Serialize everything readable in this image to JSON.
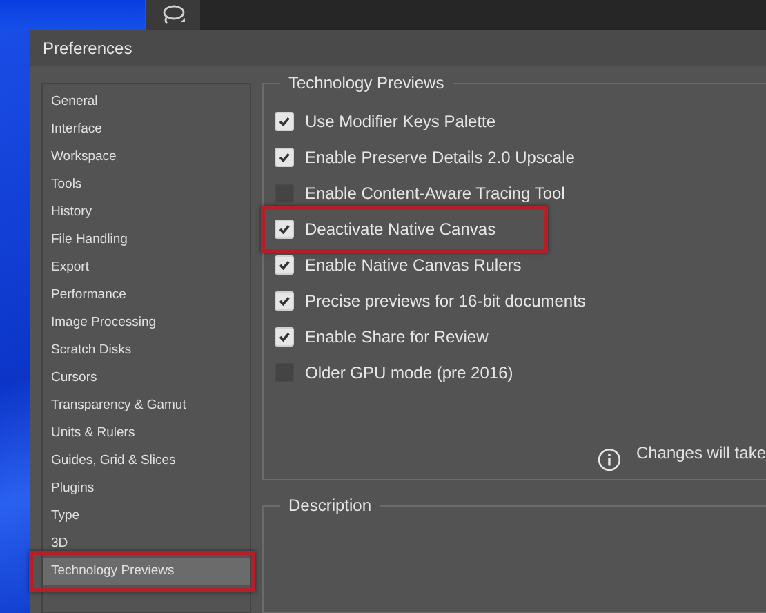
{
  "window": {
    "title": "Preferences"
  },
  "sidebar": {
    "items": [
      {
        "label": "General",
        "selected": false,
        "highlighted": false
      },
      {
        "label": "Interface",
        "selected": false,
        "highlighted": false
      },
      {
        "label": "Workspace",
        "selected": false,
        "highlighted": false
      },
      {
        "label": "Tools",
        "selected": false,
        "highlighted": false
      },
      {
        "label": "History",
        "selected": false,
        "highlighted": false
      },
      {
        "label": "File Handling",
        "selected": false,
        "highlighted": false
      },
      {
        "label": "Export",
        "selected": false,
        "highlighted": false
      },
      {
        "label": "Performance",
        "selected": false,
        "highlighted": false
      },
      {
        "label": "Image Processing",
        "selected": false,
        "highlighted": false
      },
      {
        "label": "Scratch Disks",
        "selected": false,
        "highlighted": false
      },
      {
        "label": "Cursors",
        "selected": false,
        "highlighted": false
      },
      {
        "label": "Transparency & Gamut",
        "selected": false,
        "highlighted": false
      },
      {
        "label": "Units & Rulers",
        "selected": false,
        "highlighted": false
      },
      {
        "label": "Guides, Grid & Slices",
        "selected": false,
        "highlighted": false
      },
      {
        "label": "Plugins",
        "selected": false,
        "highlighted": false
      },
      {
        "label": "Type",
        "selected": false,
        "highlighted": false
      },
      {
        "label": "3D",
        "selected": false,
        "highlighted": false
      },
      {
        "label": "Technology Previews",
        "selected": true,
        "highlighted": true
      }
    ]
  },
  "technology_previews": {
    "title": "Technology Previews",
    "options": [
      {
        "label": "Use Modifier Keys Palette",
        "checked": true,
        "highlighted": false
      },
      {
        "label": "Enable Preserve Details 2.0 Upscale",
        "checked": true,
        "highlighted": false
      },
      {
        "label": "Enable Content-Aware Tracing Tool",
        "checked": false,
        "highlighted": false
      },
      {
        "label": "Deactivate Native Canvas",
        "checked": true,
        "highlighted": true
      },
      {
        "label": "Enable Native Canvas Rulers",
        "checked": true,
        "highlighted": false
      },
      {
        "label": "Precise previews for 16-bit documents",
        "checked": true,
        "highlighted": false
      },
      {
        "label": "Enable Share for Review",
        "checked": true,
        "highlighted": false
      },
      {
        "label": "Older GPU mode (pre 2016)",
        "checked": false,
        "highlighted": false
      }
    ],
    "notice": "Changes will take"
  },
  "description": {
    "title": "Description"
  }
}
